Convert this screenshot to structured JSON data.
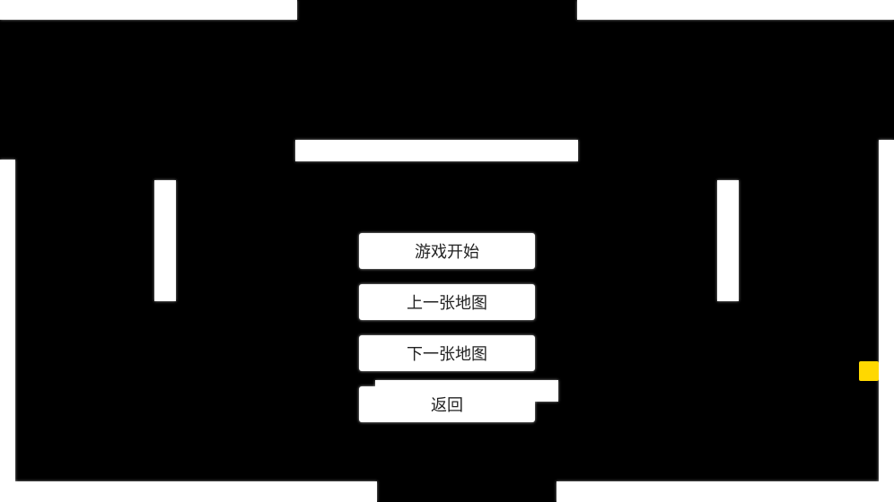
{
  "menu": {
    "start_label": "游戏开始",
    "prev_map_label": "上一张地图",
    "next_map_label": "下一张地图",
    "back_label": "返回"
  },
  "colors": {
    "background": "#000000",
    "wall": "#ffffff",
    "player": "#ffd800"
  }
}
